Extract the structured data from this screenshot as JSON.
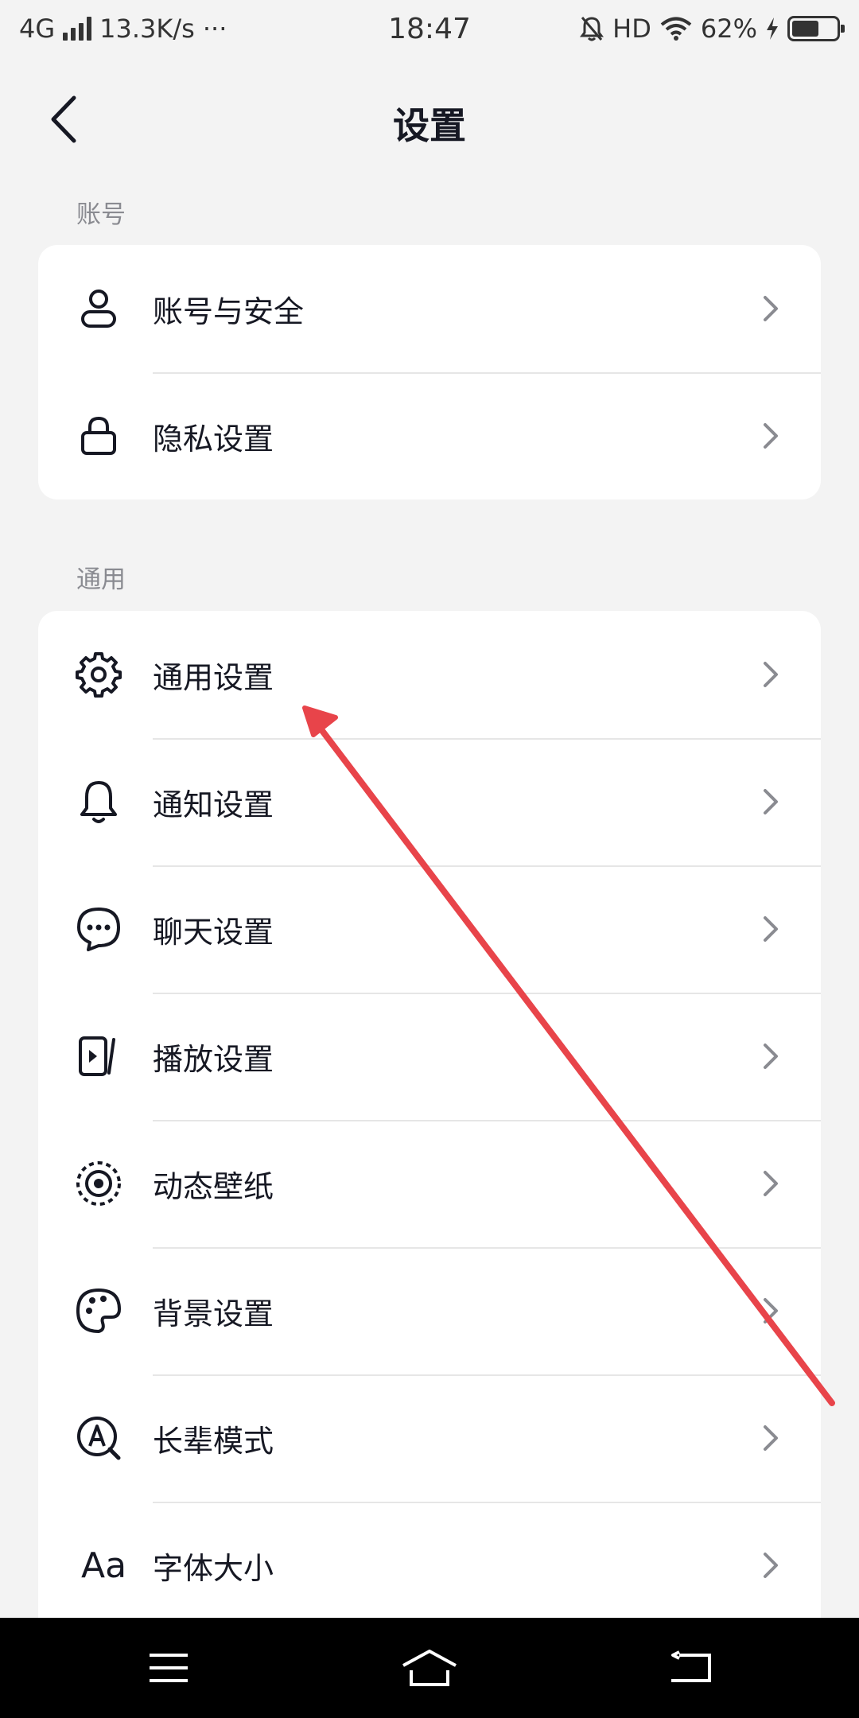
{
  "status_bar": {
    "network": "4G",
    "speed": "13.3K/s",
    "more": "···",
    "time": "18:47",
    "hd": "HD",
    "battery_percent": "62%",
    "battery_level": 0.62
  },
  "header": {
    "title": "设置"
  },
  "sections": {
    "account": {
      "label": "账号",
      "items": [
        {
          "label": "账号与安全",
          "icon": "person-icon"
        },
        {
          "label": "隐私设置",
          "icon": "lock-icon"
        }
      ]
    },
    "general": {
      "label": "通用",
      "items": [
        {
          "label": "通用设置",
          "icon": "gear-icon"
        },
        {
          "label": "通知设置",
          "icon": "bell-icon"
        },
        {
          "label": "聊天设置",
          "icon": "chat-bubble-icon"
        },
        {
          "label": "播放设置",
          "icon": "play-screen-icon"
        },
        {
          "label": "动态壁纸",
          "icon": "live-wallpaper-icon"
        },
        {
          "label": "背景设置",
          "icon": "palette-icon"
        },
        {
          "label": "长辈模式",
          "icon": "elder-mode-icon"
        },
        {
          "label": "字体大小",
          "icon": "font-size-icon",
          "glyph": "Aa"
        }
      ]
    }
  },
  "system_nav": {
    "icons": [
      "menu-icon",
      "home-icon",
      "back-icon"
    ]
  },
  "colors": {
    "background": "#f3f3f3",
    "card": "#ffffff",
    "text": "#161823",
    "section_label": "#8a8b91",
    "chevron": "#8a8b91",
    "annotation_arrow": "#e8444a"
  }
}
